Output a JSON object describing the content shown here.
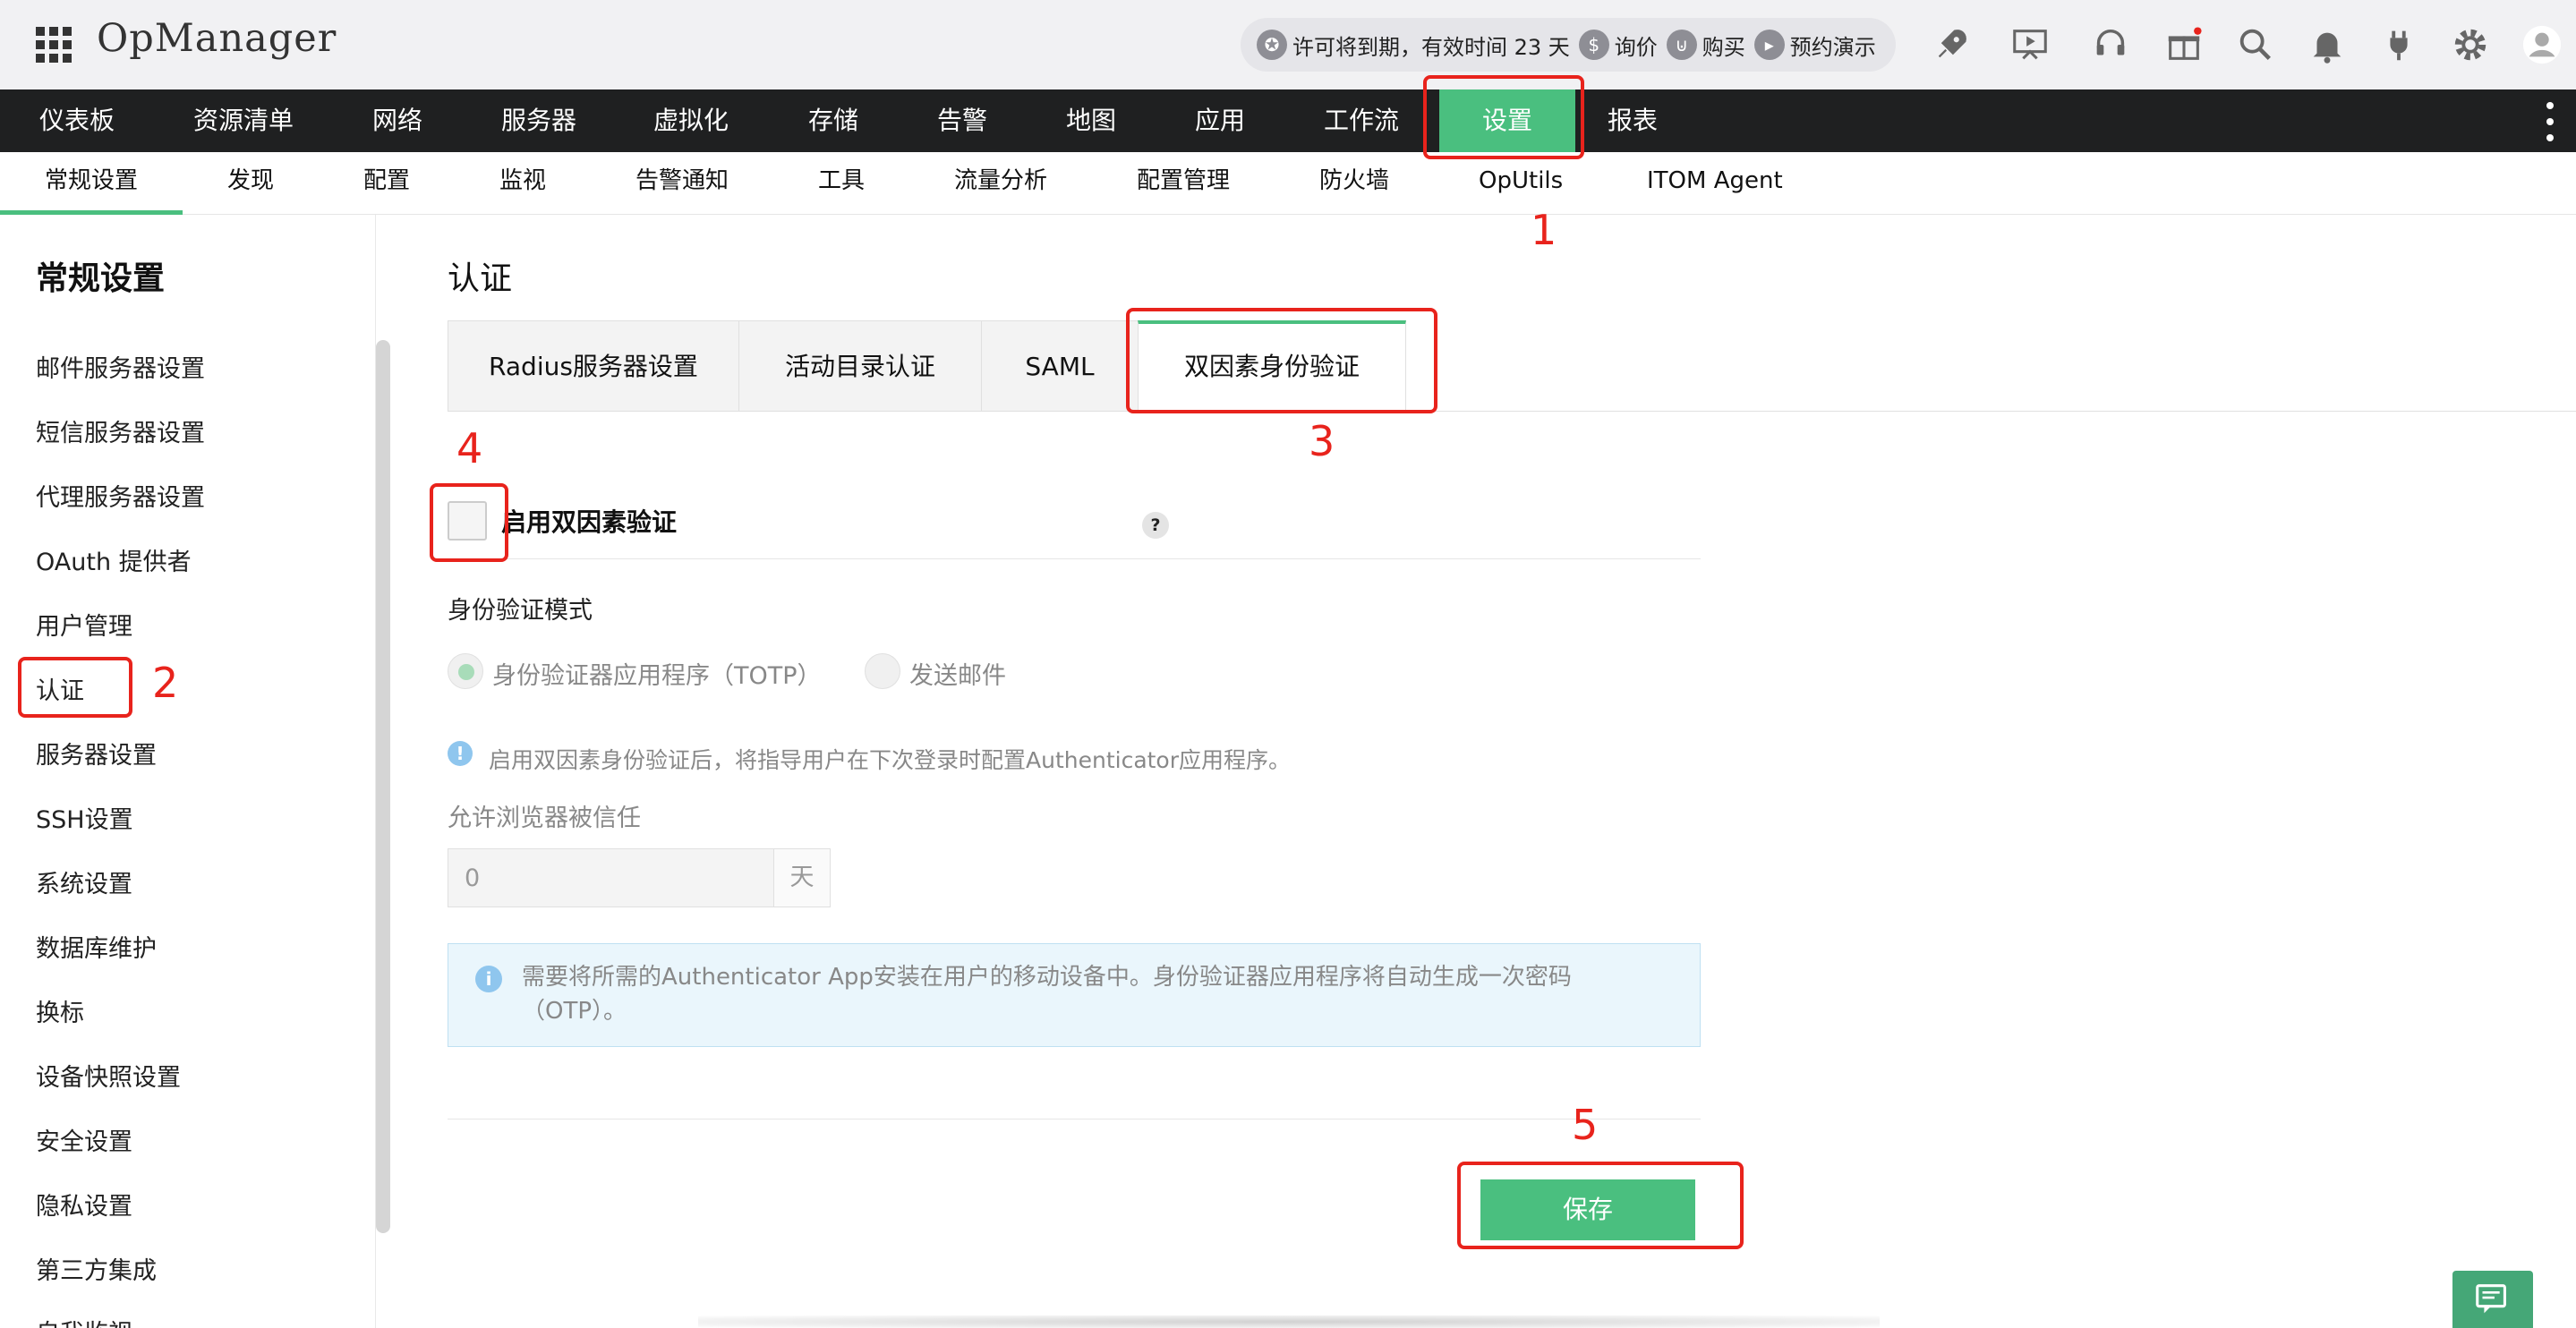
{
  "app": {
    "title": "OpManager"
  },
  "license": {
    "text": "许可将到期，有效时间 23 天",
    "actions": [
      "询价",
      "购买",
      "预约演示"
    ]
  },
  "mainnav": {
    "items": [
      "仪表板",
      "资源清单",
      "网络",
      "服务器",
      "虚拟化",
      "存储",
      "告警",
      "地图",
      "应用",
      "工作流",
      "设置",
      "报表"
    ],
    "active": "设置"
  },
  "subnav": {
    "items": [
      "常规设置",
      "发现",
      "配置",
      "监视",
      "告警通知",
      "工具",
      "流量分析",
      "配置管理",
      "防火墙",
      "OpUtils",
      "ITOM Agent"
    ],
    "active": "常规设置"
  },
  "sidebar": {
    "title": "常规设置",
    "items": [
      "邮件服务器设置",
      "短信服务器设置",
      "代理服务器设置",
      "OAuth 提供者",
      "用户管理",
      "认证",
      "服务器设置",
      "SSH设置",
      "系统设置",
      "数据库维护",
      "换标",
      "设备快照设置",
      "安全设置",
      "隐私设置",
      "第三方集成",
      "自我监视"
    ],
    "active": "认证"
  },
  "content": {
    "title": "认证",
    "tabs": [
      "Radius服务器设置",
      "活动目录认证",
      "SAML",
      "双因素身份验证"
    ],
    "active_tab": "双因素身份验证",
    "enable_label": "启用双因素验证",
    "help": "?",
    "mode_label": "身份验证模式",
    "mode_options": [
      "身份验证器应用程序（TOTP）",
      "发送邮件"
    ],
    "mode_selected": "身份验证器应用程序（TOTP）",
    "note": "启用双因素身份验证后，将指导用户在下次登录时配置Authenticator应用程序。",
    "trust_label": "允许浏览器被信任",
    "trust_value": "0",
    "trust_unit": "天",
    "info_text": "需要将所需的Authenticator App安装在用户的移动设备中。身份验证器应用程序将自动生成一次密码（OTP）。",
    "save_label": "保存"
  },
  "annotations": [
    "1",
    "2",
    "3",
    "4",
    "5"
  ],
  "colors": {
    "accent": "#4abf7f",
    "nav_bg": "#1f2021",
    "annotation": "#e8231c"
  }
}
